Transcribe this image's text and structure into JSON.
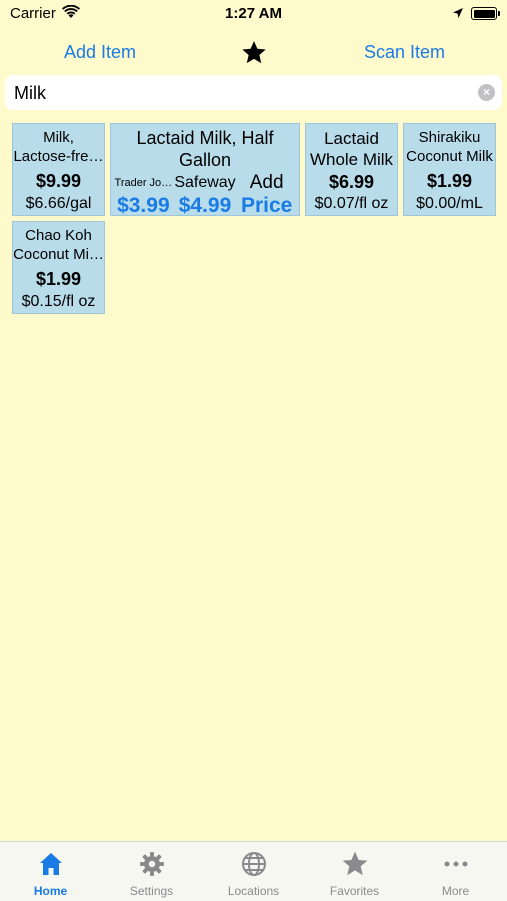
{
  "status": {
    "carrier": "Carrier",
    "time": "1:27 AM"
  },
  "nav": {
    "add_item": "Add Item",
    "scan_item": "Scan Item"
  },
  "search": {
    "value": "Milk"
  },
  "cards": [
    {
      "name": "Milk, Lactose-fre…",
      "price": "$9.99",
      "unit": "$6.66/gal"
    },
    {
      "name": "Lactaid Milk, Half Gallon",
      "stores": [
        {
          "store": "Trader Jo…",
          "price": "$3.99"
        },
        {
          "store": "Safeway",
          "price": "$4.99"
        },
        {
          "store": "Add",
          "price": "Price"
        }
      ]
    },
    {
      "name": "Lactaid Whole Milk",
      "price": "$6.99",
      "unit": "$0.07/fl oz"
    },
    {
      "name": "Shirakiku Coconut Milk",
      "price": "$1.99",
      "unit": "$0.00/mL"
    },
    {
      "name": "Chao Koh Coconut Mi…",
      "price": "$1.99",
      "unit": "$0.15/fl oz"
    }
  ],
  "tabs": [
    {
      "label": "Home",
      "icon": "home-icon",
      "active": true
    },
    {
      "label": "Settings",
      "icon": "gear-icon"
    },
    {
      "label": "Locations",
      "icon": "globe-icon"
    },
    {
      "label": "Favorites",
      "icon": "star-icon"
    },
    {
      "label": "More",
      "icon": "more-icon"
    }
  ],
  "colors": {
    "background": "#fefacc",
    "accent": "#1a7be5",
    "card": "#b8dcea",
    "tab_inactive": "#8a8a8e"
  }
}
